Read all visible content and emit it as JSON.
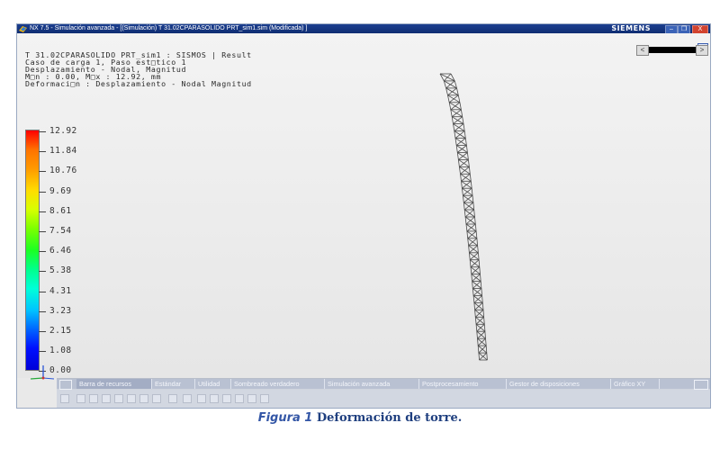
{
  "window": {
    "title": "NX 7.5 - Simulación avanzada - [(Simulación) T 31.02CPARASOLIDO PRT_sim1.sim (Modificada) ]",
    "brand": "SIEMENS",
    "controls": {
      "minimize": "–",
      "maximize": "❐",
      "close": "X"
    }
  },
  "viewport": {
    "info_lines": [
      "T 31.02CPARASOLIDO PRT_sim1 : SISMOS | Result",
      "Caso de carga 1, Paso est□tico 1",
      "Desplazamiento - Nodal, Magnitud",
      "M□n : 0.00, M□x : 12.92, mm",
      "Deformaci□n : Desplazamiento - Nodal Magnitud"
    ],
    "legend": {
      "values": [
        "12.92",
        "11.84",
        "10.76",
        "9.69",
        "8.61",
        "7.54",
        "6.46",
        "5.38",
        "4.31",
        "3.23",
        "2.15",
        "1.08",
        "0.00"
      ],
      "colors": [
        "#ff0000",
        "#ff7200",
        "#ff9a00",
        "#ffdc00",
        "#d8ff00",
        "#7cff00",
        "#1cff22",
        "#00ff8c",
        "#00ffd8",
        "#00c4ff",
        "#0066ff",
        "#0010ff",
        "#0000d8"
      ]
    },
    "scroll": {
      "left": "<",
      "right": ">"
    }
  },
  "toolbar": {
    "tabs": [
      "Barra de recursos",
      "Estándar",
      "Utilidad",
      "Sombreado verdadero",
      "Simulación avanzada",
      "Postprocesamiento",
      "Gestor de disposiciones",
      "Gráfico XY"
    ],
    "extra": "☰"
  },
  "caption": {
    "figure": "Figura 1",
    "text": " Deformación de torre."
  }
}
